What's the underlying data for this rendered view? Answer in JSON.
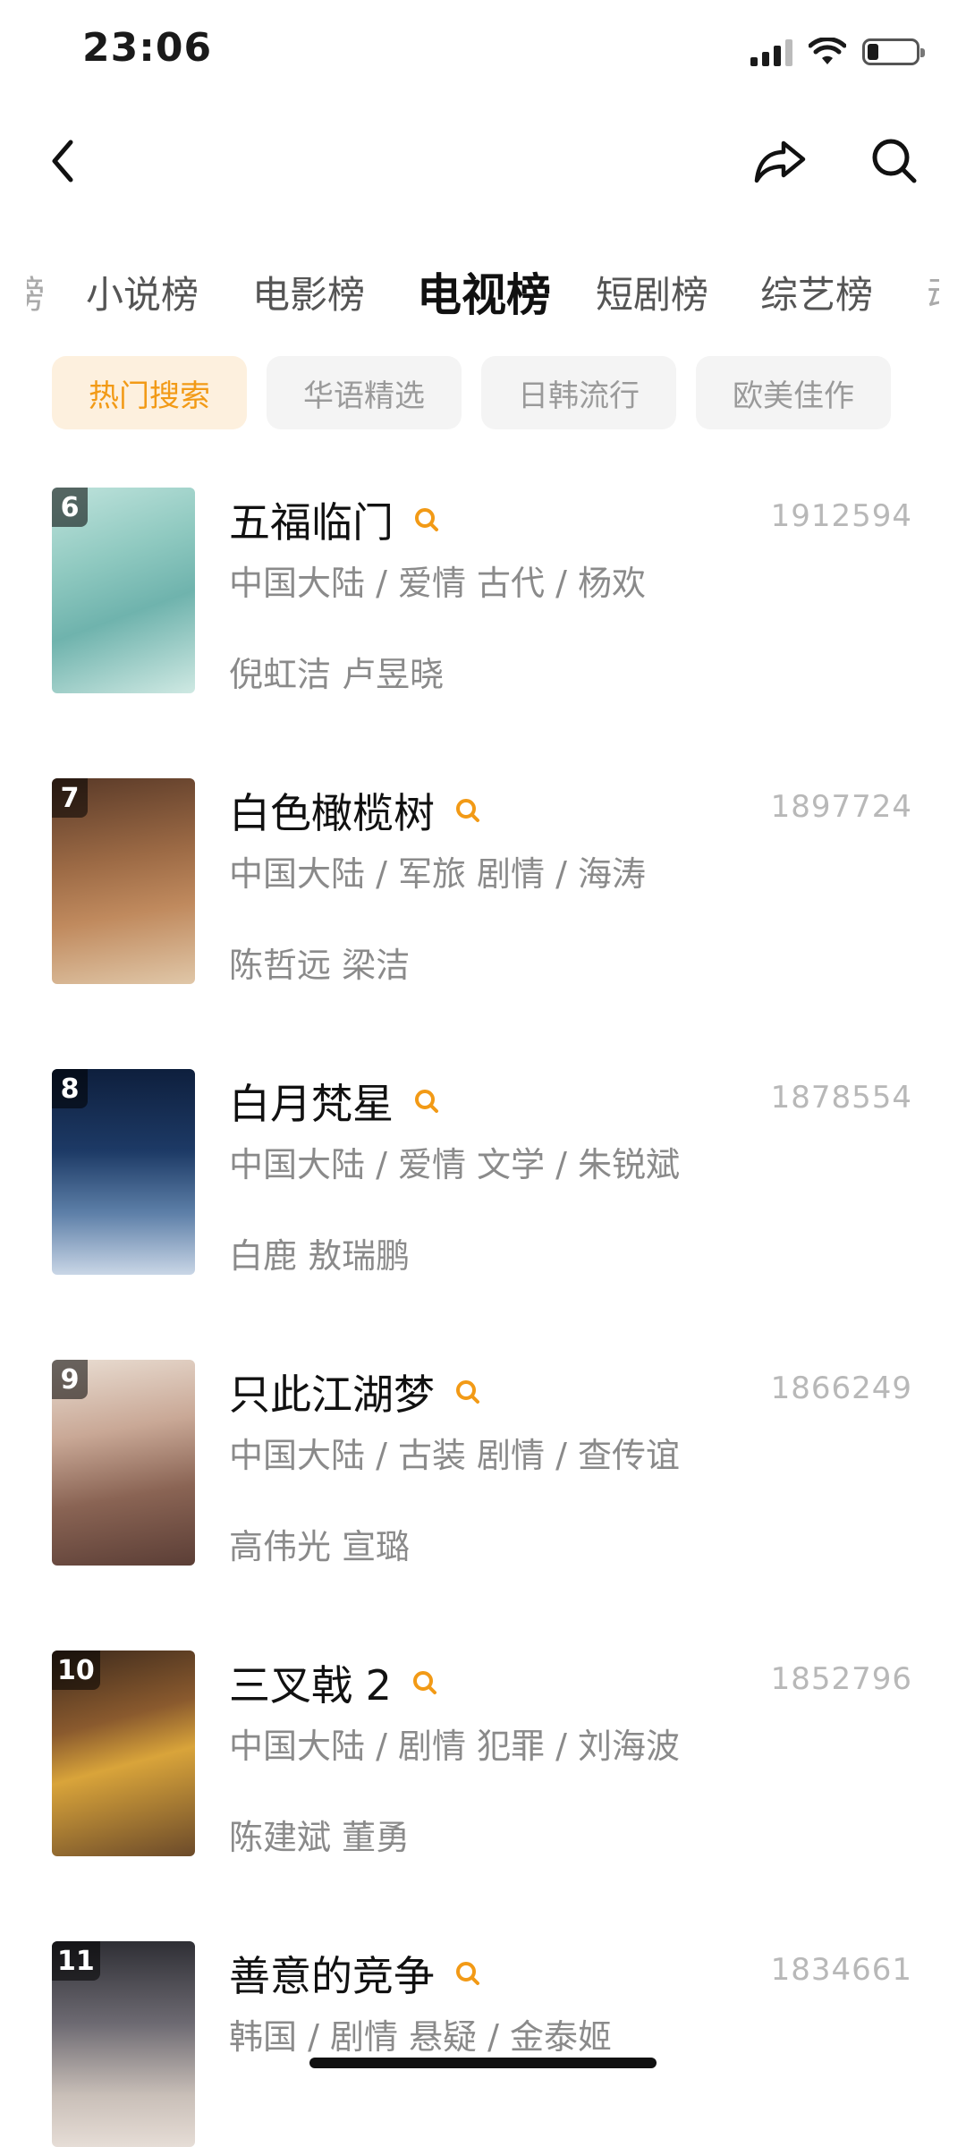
{
  "status": {
    "time": "23:06"
  },
  "tabs": [
    {
      "label": "榜",
      "state": "fade"
    },
    {
      "label": "小说榜",
      "state": "normal"
    },
    {
      "label": "电影榜",
      "state": "normal"
    },
    {
      "label": "电视榜",
      "state": "active"
    },
    {
      "label": "短剧榜",
      "state": "normal"
    },
    {
      "label": "综艺榜",
      "state": "normal"
    },
    {
      "label": "动",
      "state": "fade"
    }
  ],
  "chips": [
    {
      "label": "热门搜索",
      "active": true
    },
    {
      "label": "华语精选",
      "active": false
    },
    {
      "label": "日韩流行",
      "active": false
    },
    {
      "label": "欧美佳作",
      "active": false
    }
  ],
  "items": [
    {
      "rank": "6",
      "title": "五福临门",
      "score": "1912594",
      "meta": "中国大陆 / 爱情 古代 / 杨欢",
      "cast": "倪虹洁 卢昱晓"
    },
    {
      "rank": "7",
      "title": "白色橄榄树",
      "score": "1897724",
      "meta": "中国大陆 / 军旅 剧情 / 海涛",
      "cast": "陈哲远 梁洁"
    },
    {
      "rank": "8",
      "title": "白月梵星",
      "score": "1878554",
      "meta": "中国大陆 / 爱情 文学 / 朱锐斌",
      "cast": "白鹿 敖瑞鹏"
    },
    {
      "rank": "9",
      "title": "只此江湖梦",
      "score": "1866249",
      "meta": "中国大陆 / 古装 剧情 / 查传谊",
      "cast": "高伟光 宣璐"
    },
    {
      "rank": "10",
      "title": "三叉戟 2",
      "score": "1852796",
      "meta": "中国大陆 / 剧情 犯罪 / 刘海波",
      "cast": "陈建斌 董勇"
    },
    {
      "rank": "11",
      "title": "善意的竞争",
      "score": "1834661",
      "meta": "韩国 / 剧情 悬疑 / 金泰姬",
      "cast": ""
    }
  ],
  "colors": {
    "accent": "#f29a16",
    "chip_active_bg": "#fdf0de"
  },
  "icons": [
    "back-arrow-icon",
    "share-icon",
    "search-icon",
    "search-small-icon"
  ]
}
